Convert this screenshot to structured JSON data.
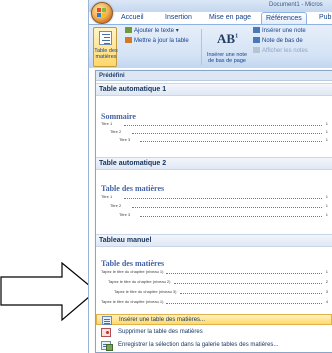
{
  "window": {
    "title": "Document1 - Micros"
  },
  "ribbon": {
    "tabs": [
      "Accueil",
      "Insertion",
      "Mise en page",
      "Références",
      "Pub"
    ],
    "active_tab_index": 3,
    "toc_button_label": "Table des matières",
    "add_text_label": "Ajouter le texte",
    "update_table_label": "Mettre à jour la table",
    "insert_note_label": "Insérer une note de bas de page",
    "insert_endnote_label": "Insérer une note",
    "next_note_label": "Note de bas de",
    "show_notes_label": "Afficher les notes",
    "ab_icon_text": "AB",
    "ab_icon_sup": "1"
  },
  "menu": {
    "section_heading": "Prédéfini",
    "galleries": [
      {
        "heading": "Table automatique 1",
        "title": "Sommaire",
        "entries": [
          {
            "text": "Titre 1",
            "page": "1"
          },
          {
            "text": "Titre 2",
            "page": "1"
          },
          {
            "text": "Titre 3",
            "page": "1"
          }
        ]
      },
      {
        "heading": "Table automatique 2",
        "title": "Table des matières",
        "entries": [
          {
            "text": "Titre 1",
            "page": "1"
          },
          {
            "text": "Titre 2",
            "page": "1"
          },
          {
            "text": "Titre 3",
            "page": "1"
          }
        ]
      },
      {
        "heading": "Tableau manuel",
        "title": "Table des matières",
        "entries": [
          {
            "text": "Tapez le titre du chapitre (niveau 1)",
            "page": "1"
          },
          {
            "text": "Tapez le titre du chapitre (niveau 2)",
            "page": "2"
          },
          {
            "text": "Tapez le titre du chapitre (niveau 3)",
            "page": "3"
          },
          {
            "text": "Tapez le titre du chapitre (niveau 1)",
            "page": "4"
          }
        ]
      }
    ],
    "commands": [
      {
        "label": "Insérer une table des matières...",
        "icon": "insert-toc-icon",
        "highlighted": true
      },
      {
        "label": "Supprimer la table des matières",
        "icon": "remove-toc-icon",
        "highlighted": false
      },
      {
        "label": "Enregistrer la sélection dans la galerie tables des matières...",
        "icon": "save-selection-icon",
        "highlighted": false
      }
    ]
  },
  "colors": {
    "ribbon_blue": "#d4e3f5",
    "highlight": "#ffd96a",
    "title_blue": "#4563a6"
  }
}
